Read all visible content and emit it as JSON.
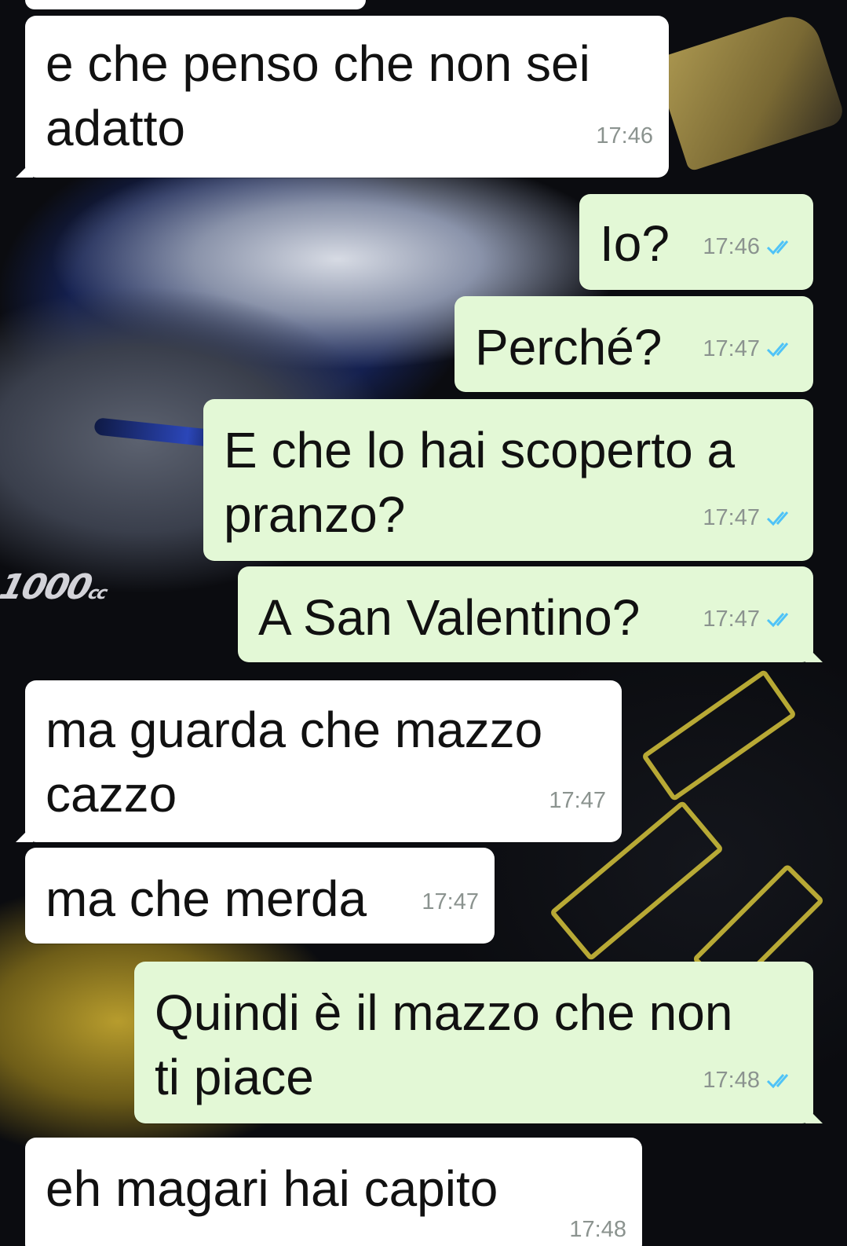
{
  "colors": {
    "incoming_bubble": "#ffffff",
    "outgoing_bubble": "#e3f8d6",
    "timestamp": "#8b938f",
    "read_ticks": "#4fc3f7"
  },
  "wallpaper": {
    "badge_text": "1000",
    "badge_unit": "cc"
  },
  "messages": [
    {
      "direction": "in",
      "text": "e che penso che non sei\nadatto",
      "time": "17:46"
    },
    {
      "direction": "out",
      "text": "Io?",
      "time": "17:46",
      "status_icon": "double-check-icon"
    },
    {
      "direction": "out",
      "text": "Perché?",
      "time": "17:47",
      "status_icon": "double-check-icon"
    },
    {
      "direction": "out",
      "text": "E che lo hai scoperto a\npranzo?",
      "time": "17:47",
      "status_icon": "double-check-icon"
    },
    {
      "direction": "out",
      "text": "A San Valentino?",
      "time": "17:47",
      "status_icon": "double-check-icon"
    },
    {
      "direction": "in",
      "text": "ma guarda che mazzo\ncazzo",
      "time": "17:47"
    },
    {
      "direction": "in",
      "text": "ma che merda",
      "time": "17:47"
    },
    {
      "direction": "out",
      "text": "Quindi è il mazzo che non\nti piace",
      "time": "17:48",
      "status_icon": "double-check-icon"
    },
    {
      "direction": "in",
      "text": "eh magari hai capito",
      "time": "17:48"
    }
  ]
}
